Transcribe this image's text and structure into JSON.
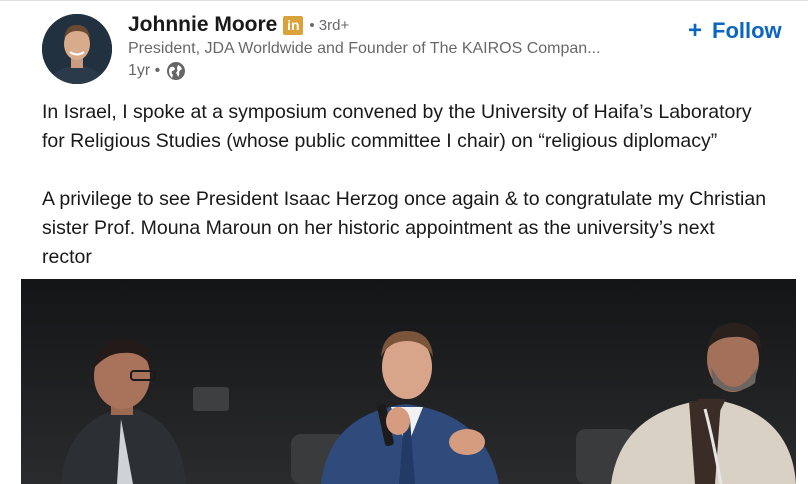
{
  "post": {
    "actor": {
      "name": "Johnnie Moore",
      "badge_icon": "linkedin-premium-icon",
      "badge_text": "in",
      "degree": "• 3rd+",
      "headline": "President, JDA Worldwide and Founder of The KAIROS Compan...",
      "time": "1yr •",
      "visibility_icon": "globe-icon"
    },
    "follow_label": "Follow",
    "follow_icon": "plus-icon",
    "more_icon": "more-options-icon",
    "commentary": [
      "In Israel, I spoke at a symposium convened by the University of Haifa’s Laboratory\nfor Religious Studies (whose public committee I chair) on “religious diplomacy”",
      "A privilege to see President Isaac Herzog once again & to congratulate my Christian\nsister Prof. Mouna Maroun on her historic appointment as the university’s next\nrector"
    ]
  },
  "colors": {
    "link": "#0a66c2",
    "text": "#191919",
    "muted": "#666666",
    "premium_badge": "#d9a23a"
  }
}
